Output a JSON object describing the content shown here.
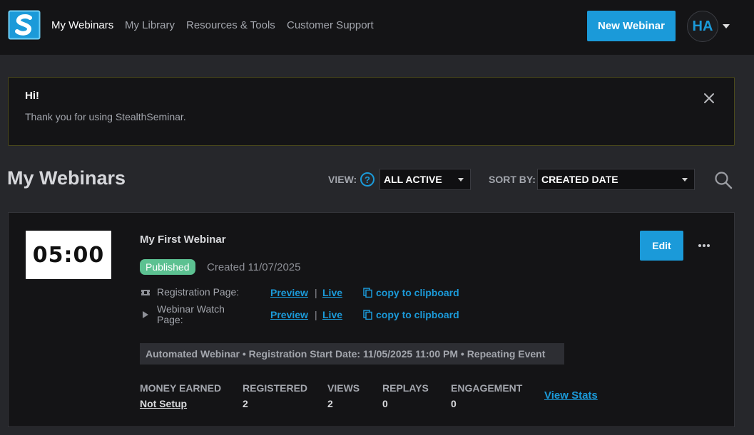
{
  "nav": {
    "links": [
      "My Webinars",
      "My Library",
      "Resources & Tools",
      "Customer Support"
    ],
    "new_webinar": "New Webinar",
    "avatar_initials": "HA"
  },
  "alert": {
    "title": "Hi!",
    "message": "Thank you for using StealthSeminar."
  },
  "page": {
    "title": "My Webinars",
    "view_label": "VIEW:",
    "help_glyph": "?",
    "view_value": "ALL ACTIVE",
    "sort_label": "SORT BY:",
    "sort_value": "CREATED DATE"
  },
  "webinar": {
    "thumbnail_time": "05:00",
    "title": "My First Webinar",
    "status": "Published",
    "created": "Created 11/07/2025",
    "rows": [
      {
        "label": "Registration Page:",
        "preview": "Preview",
        "separator": "|",
        "live": "Live",
        "copy": "copy to clipboard"
      },
      {
        "label": "Webinar Watch Page:",
        "preview": "Preview",
        "separator": "|",
        "live": "Live",
        "copy": "copy to clipboard"
      }
    ],
    "info": "Automated Webinar • Registration Start Date: 11/05/2025 11:00 PM • Repeating Event",
    "stats": [
      {
        "label": "MONEY EARNED",
        "value": "Not Setup"
      },
      {
        "label": "REGISTERED",
        "value": "2"
      },
      {
        "label": "VIEWS",
        "value": "2"
      },
      {
        "label": "REPLAYS",
        "value": "0"
      },
      {
        "label": "ENGAGEMENT",
        "value": "0"
      }
    ],
    "view_stats": "View Stats",
    "edit": "Edit"
  },
  "colors": {
    "accent": "#1b9ad9",
    "published": "#5cc191",
    "background": "#26272b",
    "surface": "#141416"
  }
}
